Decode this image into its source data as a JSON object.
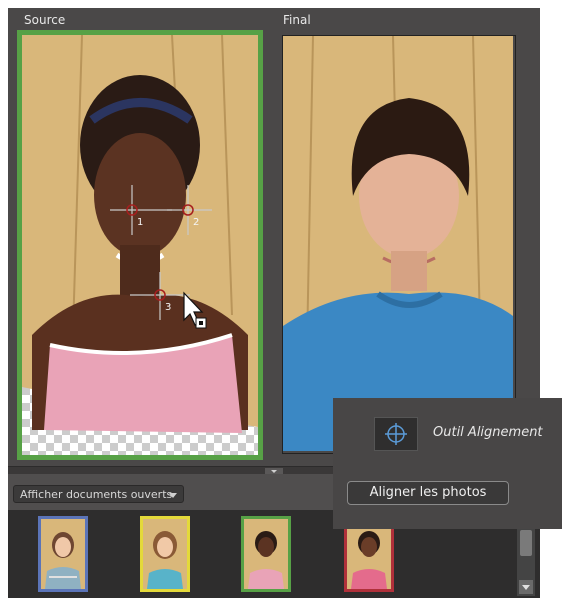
{
  "panels": {
    "source_label": "Source",
    "final_label": "Final"
  },
  "markers": [
    "1",
    "2",
    "3"
  ],
  "bin": {
    "documents_select_value": "Afficher documents ouverts"
  },
  "thumbnails": [
    {
      "name": "thumb-1",
      "border_color": "#5b74b8"
    },
    {
      "name": "thumb-2",
      "border_color": "#e4d93a"
    },
    {
      "name": "thumb-3",
      "border_color": "#57a146"
    },
    {
      "name": "thumb-4",
      "border_color": "#b0303a"
    }
  ],
  "tool_panel": {
    "tool_name": "Outil Alignement",
    "align_button": "Aligner les photos"
  },
  "colors": {
    "source_highlight": "#57a146",
    "panel_bg": "#4a4848",
    "bin_bg": "#2e2d2d"
  }
}
